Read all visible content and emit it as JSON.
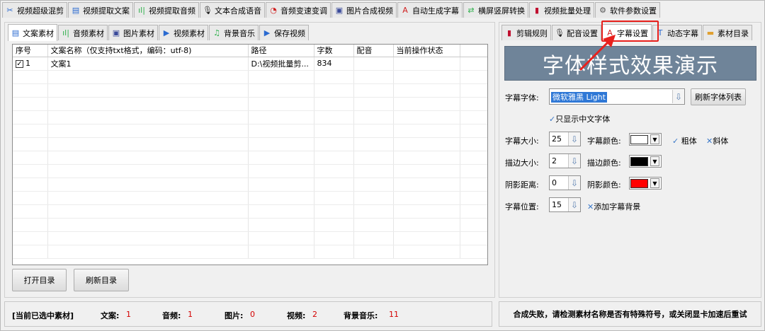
{
  "top_tabs": [
    {
      "label": "视频超级混剪",
      "icon": "scissors-icon",
      "glyph": "✂",
      "color": "#2a6ad0"
    },
    {
      "label": "视频提取文案",
      "icon": "document-icon",
      "glyph": "▤",
      "color": "#2a6ad0"
    },
    {
      "label": "视频提取音频",
      "icon": "audio-wave-icon",
      "glyph": "ıl|",
      "color": "#2db04a"
    },
    {
      "label": "文本合成语音",
      "icon": "microphone-icon",
      "glyph": "🎙",
      "color": "#222"
    },
    {
      "label": "音频变速变调",
      "icon": "speed-dial-icon",
      "glyph": "◔",
      "color": "#d02020"
    },
    {
      "label": "图片合成视频",
      "icon": "image-icon",
      "glyph": "▣",
      "color": "#3a4a9a"
    },
    {
      "label": "自动生成字幕",
      "icon": "font-a-icon",
      "glyph": "A",
      "color": "#d02020"
    },
    {
      "label": "横屏竖屏转换",
      "icon": "rotate-screen-icon",
      "glyph": "⇄",
      "color": "#2db04a"
    },
    {
      "label": "视频批量处理",
      "icon": "film-icon",
      "glyph": "▮",
      "color": "#c01030"
    },
    {
      "label": "软件参数设置",
      "icon": "gear-icon",
      "glyph": "⚙",
      "color": "#555"
    }
  ],
  "left_tabs": [
    {
      "label": "文案素材",
      "icon": "document-icon",
      "glyph": "▤",
      "color": "#2a6ad0"
    },
    {
      "label": "音频素材",
      "icon": "audio-wave-icon",
      "glyph": "ıl|",
      "color": "#2db04a"
    },
    {
      "label": "图片素材",
      "icon": "image-icon",
      "glyph": "▣",
      "color": "#3a4a9a"
    },
    {
      "label": "视频素材",
      "icon": "play-icon",
      "glyph": "▶",
      "color": "#2a6ad0"
    },
    {
      "label": "背景音乐",
      "icon": "music-note-icon",
      "glyph": "♫",
      "color": "#2db04a"
    },
    {
      "label": "保存视频",
      "icon": "save-icon",
      "glyph": "▶",
      "color": "#2a6ad0"
    }
  ],
  "table": {
    "columns": [
      "序号",
      "文案名称（仅支持txt格式，编码：utf-8)",
      "路径",
      "字数",
      "配音",
      "当前操作状态"
    ],
    "rows": [
      {
        "index": "1",
        "checked": true,
        "name": "文案1",
        "path": "D:\\视频批量剪...",
        "count": "834",
        "dub": "",
        "status": ""
      }
    ]
  },
  "buttons": {
    "open_dir": "打开目录",
    "refresh_dir": "刷新目录",
    "refresh_fonts": "刷新字体列表"
  },
  "status": {
    "title": "[当前已选中素材]",
    "items": [
      {
        "label": "文案:",
        "value": "1"
      },
      {
        "label": "音频:",
        "value": "1"
      },
      {
        "label": "图片:",
        "value": "0"
      },
      {
        "label": "视频:",
        "value": "2"
      },
      {
        "label": "背景音乐:",
        "value": "11"
      }
    ],
    "message": "合成失败，请检测素材名称是否有特殊符号，或关闭显卡加速后重试"
  },
  "right_tabs": [
    {
      "label": "剪辑规则",
      "icon": "film-icon",
      "glyph": "▮",
      "color": "#c01030"
    },
    {
      "label": "配音设置",
      "icon": "microphone-icon",
      "glyph": "🎙",
      "color": "#222"
    },
    {
      "label": "字幕设置",
      "icon": "font-a-icon",
      "glyph": "A",
      "color": "#d02020"
    },
    {
      "label": "动态字幕",
      "icon": "text-box-icon",
      "glyph": "T",
      "color": "#2a6ad0"
    },
    {
      "label": "素材目录",
      "icon": "folder-icon",
      "glyph": "▬",
      "color": "#e0a030"
    }
  ],
  "preview": {
    "text": "字体样式效果演示",
    "bg": "#6f8499"
  },
  "subtitle": {
    "font_label": "字幕字体:",
    "font_value": "微软雅黑 Light",
    "only_chinese": "只显示中文字体",
    "size_label": "字幕大小:",
    "size_value": "25",
    "color_label": "字幕颜色:",
    "color_value": "#ffffff",
    "bold": "粗体",
    "italic": "斜体",
    "stroke_label": "描边大小:",
    "stroke_value": "2",
    "stroke_color_label": "描边颜色:",
    "stroke_color_value": "#000000",
    "shadow_label": "阴影距离:",
    "shadow_value": "0",
    "shadow_color_label": "阴影颜色:",
    "shadow_color_value": "#ff0000",
    "position_label": "字幕位置:",
    "position_value": "15",
    "add_bg": "添加字幕背景"
  },
  "accent_red": "#e8201c"
}
